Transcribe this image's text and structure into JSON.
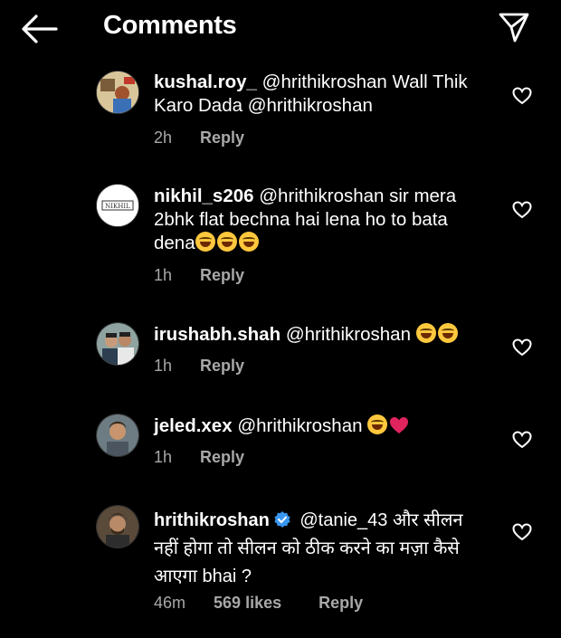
{
  "header": {
    "title": "Comments",
    "back_icon": "back-arrow-icon",
    "send_icon": "send-icon"
  },
  "comments": [
    {
      "username": "kushal.roy_",
      "text": "@hrithikroshan Wall Thik Karo Dada @hrithikroshan",
      "time": "2h",
      "reply": "Reply"
    },
    {
      "username": "nikhil_s206",
      "text": "@hrithikroshan sir mera 2bhk flat bechna hai lena ho to bata dena",
      "time": "1h",
      "reply": "Reply"
    },
    {
      "username": "irushabh.shah",
      "text": "@hrithikroshan",
      "time": "1h",
      "reply": "Reply"
    },
    {
      "username": "jeled.xex",
      "text": "@hrithikroshan",
      "time": "1h",
      "reply": "Reply"
    },
    {
      "username": "hrithikroshan",
      "text": "@tanie_43 और सीलन नहीं होगा तो सीलन को ठीक करने का मज़ा कैसे आएगा bhai ?",
      "time": "46m",
      "likes": "569 likes",
      "reply": "Reply"
    }
  ],
  "avatar_labels": {
    "nikhil": "NIKHIL"
  },
  "colors": {
    "background": "#000000",
    "text": "#ffffff",
    "meta": "#a8a8a8",
    "verified": "#3897f0"
  }
}
